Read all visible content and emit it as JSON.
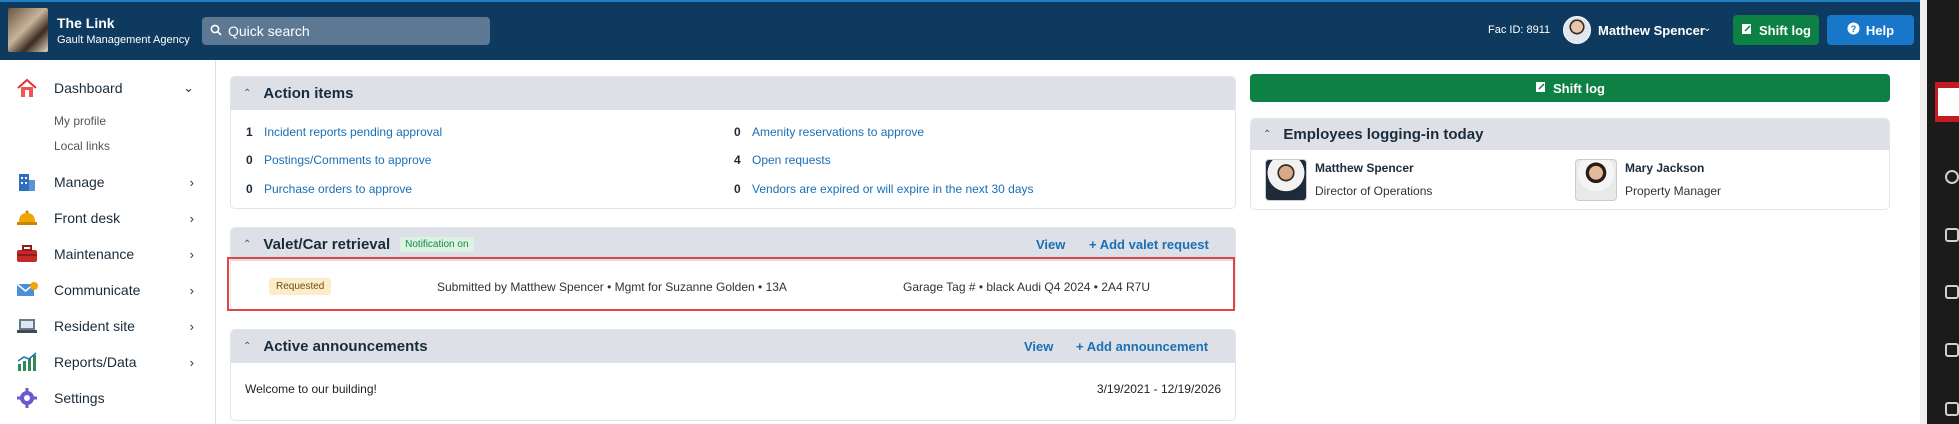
{
  "brand": {
    "title": "The Link",
    "subtitle": "Gault Management Agency"
  },
  "search": {
    "placeholder": "Quick search"
  },
  "header": {
    "fac_id": "Fac ID: 8911",
    "user_name": "Matthew Spencer",
    "shift_log_label": "Shift log",
    "help_label": "Help"
  },
  "sidebar": {
    "items": [
      {
        "label": "Dashboard",
        "icon": "home-icon"
      },
      {
        "label": "Manage",
        "icon": "building-icon"
      },
      {
        "label": "Front desk",
        "icon": "bell-icon"
      },
      {
        "label": "Maintenance",
        "icon": "toolbox-icon"
      },
      {
        "label": "Communicate",
        "icon": "mail-icon"
      },
      {
        "label": "Resident site",
        "icon": "laptop-icon"
      },
      {
        "label": "Reports/Data",
        "icon": "chart-icon"
      },
      {
        "label": "Settings",
        "icon": "gear-icon"
      }
    ],
    "subitems": [
      {
        "label": "My profile"
      },
      {
        "label": "Local links"
      }
    ]
  },
  "action_items": {
    "title": "Action items",
    "left": [
      {
        "count": "1",
        "label": "Incident reports pending approval"
      },
      {
        "count": "0",
        "label": "Postings/Comments to approve"
      },
      {
        "count": "0",
        "label": "Purchase orders to approve"
      }
    ],
    "right": [
      {
        "count": "0",
        "label": "Amenity reservations to approve"
      },
      {
        "count": "4",
        "label": "Open requests"
      },
      {
        "count": "0",
        "label": "Vendors are expired or will expire in the next 30 days"
      }
    ]
  },
  "valet": {
    "title": "Valet/Car retrieval",
    "badge": "Notification on",
    "view_label": "View",
    "add_label": "+ Add valet request",
    "row": {
      "status": "Requested",
      "submitted": "Submitted by Matthew Spencer • Mgmt for Suzanne Golden • 13A",
      "vehicle": "Garage Tag # • black Audi Q4 2024 • 2A4 R7U"
    }
  },
  "announcements": {
    "title": "Active announcements",
    "view_label": "View",
    "add_label": "+ Add announcement",
    "items": [
      {
        "text": "Welcome to our building!",
        "dates": "3/19/2021 - 12/19/2026"
      }
    ]
  },
  "right_panel": {
    "shift_log_label": "Shift log",
    "employees_title": "Employees logging-in today",
    "employees": [
      {
        "name": "Matthew Spencer",
        "role": "Director of Operations"
      },
      {
        "name": "Mary Jackson",
        "role": "Property Manager"
      }
    ]
  },
  "colors": {
    "header_bg": "#0f3a5f",
    "green": "#0d8043",
    "blue": "#1877c8",
    "link": "#1a6fb5"
  }
}
